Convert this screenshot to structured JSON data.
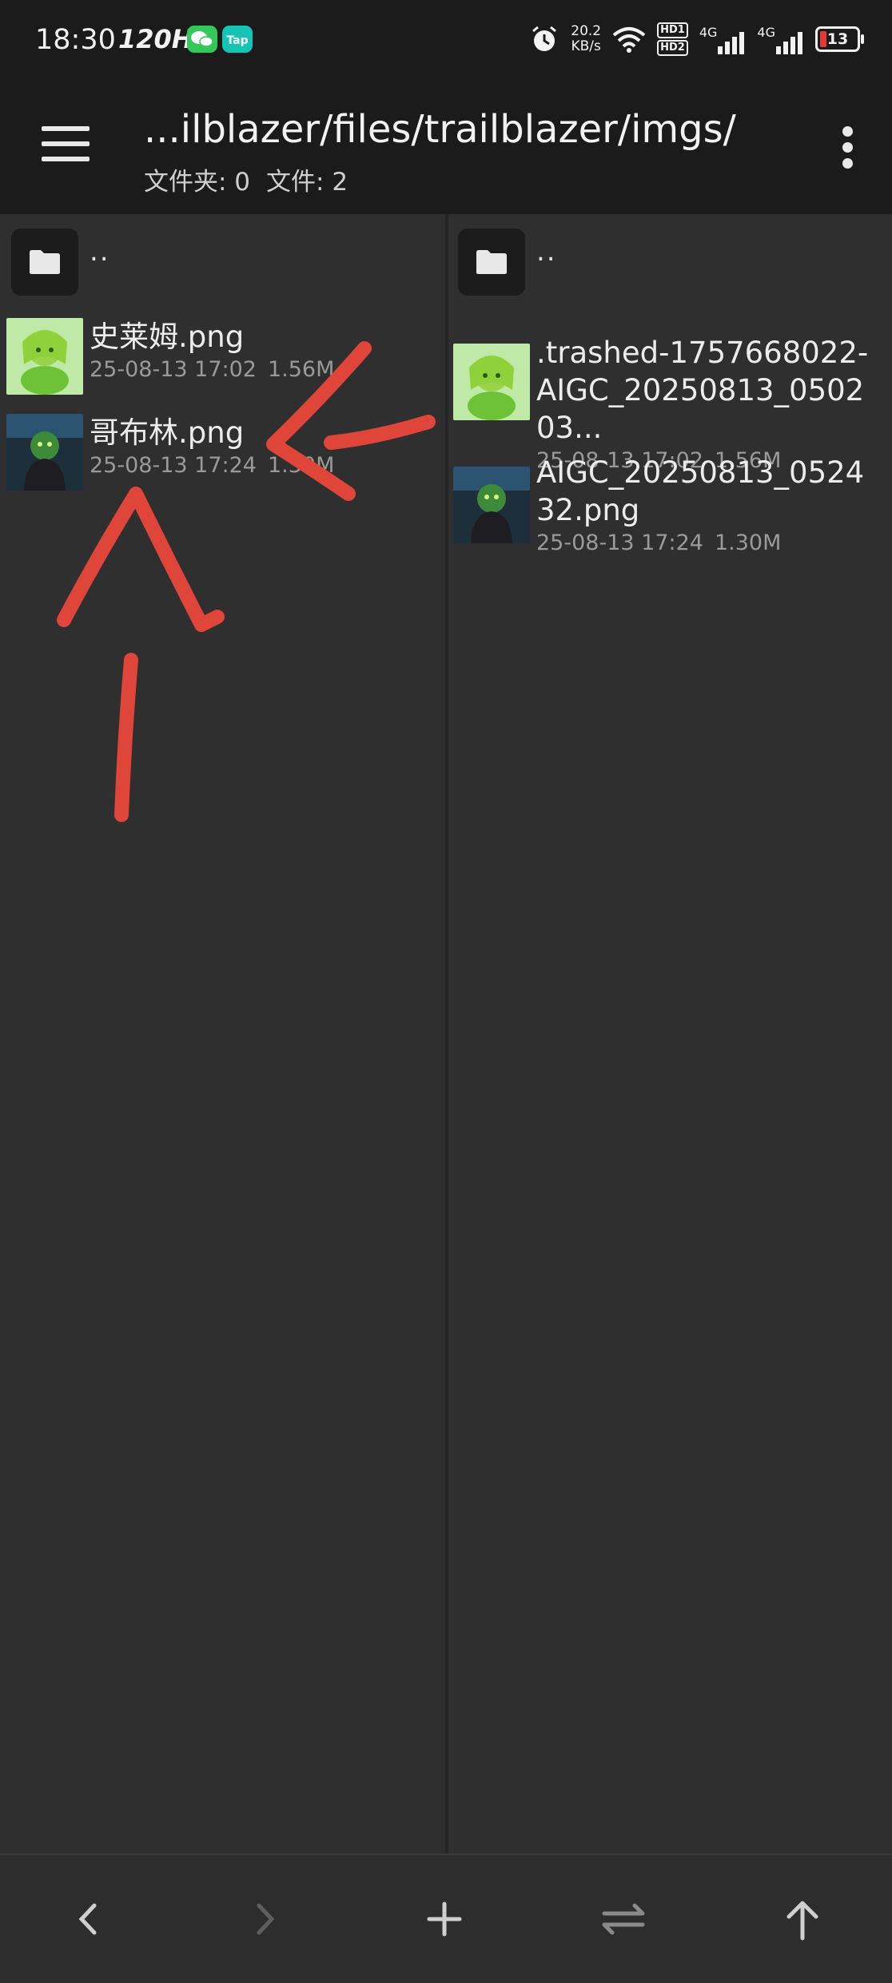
{
  "status_bar": {
    "time": "18:30",
    "refresh_rate": "120Hz",
    "net_speed_value": "20.2",
    "net_speed_unit": "KB/s",
    "hd1": "HD1",
    "hd2": "HD2",
    "sig1": "4G",
    "sig2": "4G",
    "battery": "13",
    "icons": [
      "wechat-icon",
      "taptap-icon",
      "alarm-icon",
      "wifi-icon",
      "signal-icon",
      "battery-icon"
    ]
  },
  "app_bar": {
    "title": "...ilblazer/files/trailblazer/imgs/",
    "folders_label": "文件夹: 0",
    "files_label": "文件: 2"
  },
  "left_pane": {
    "parent_label": "..",
    "files": [
      {
        "name": "史莱姆.png",
        "date": "25-08-13 17:02",
        "size": "1.56M"
      },
      {
        "name": "哥布林.png",
        "date": "25-08-13 17:24",
        "size": "1.30M"
      }
    ]
  },
  "right_pane": {
    "parent_label": "..",
    "files": [
      {
        "name": ".trashed-1757668022-AIGC_20250813_050203...",
        "date": "25-08-13 17:02",
        "size": "1.56M"
      },
      {
        "name": "AIGC_20250813_052432.png",
        "date": "25-08-13 17:24",
        "size": "1.30M"
      }
    ]
  },
  "bottom_bar": {
    "buttons": [
      "back-icon",
      "forward-icon",
      "add-icon",
      "swap-icon",
      "up-icon"
    ]
  },
  "colors": {
    "background": "#2f2f2f",
    "bar": "#1b1b1b",
    "annotation": "#e0453a"
  }
}
